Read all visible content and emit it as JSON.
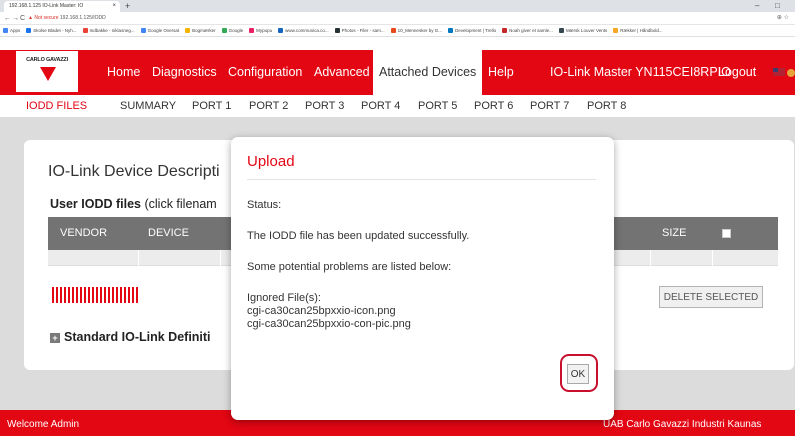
{
  "browser": {
    "tab_title": "192.168.1.125 IO-Link Master: IO",
    "tab_close": "×",
    "new_tab": "+",
    "back": "←",
    "forward": "→",
    "reload": "C",
    "warning": "▲ Not secure",
    "url": "192.168.1.125/IODD",
    "min": "–",
    "max": "□",
    "addr_icons": "⊕ ☆",
    "bookmarks": [
      {
        "label": "Apps",
        "color": "#4285f4"
      },
      {
        "label": "Skolse Bladet - Nyh...",
        "color": "#1a73e8"
      },
      {
        "label": "Indbakke - niklasneg...",
        "color": "#ea4335"
      },
      {
        "label": "Google Oversat",
        "color": "#4285f4"
      },
      {
        "label": "Bogmærker",
        "color": "#f4b400"
      },
      {
        "label": "Google",
        "color": "#34a853"
      },
      {
        "label": "Mypupu",
        "color": "#e91e63"
      },
      {
        "label": "www.communica.co...",
        "color": "#1565c0"
      },
      {
        "label": "Photos - Filer - sam...",
        "color": "#263238"
      },
      {
        "label": "10_Mennesker by G...",
        "color": "#e64a19"
      },
      {
        "label": "Development | Trello",
        "color": "#0079bf"
      },
      {
        "label": "Noah giver et samle...",
        "color": "#c62828"
      },
      {
        "label": "Mærsk Louver Vents",
        "color": "#37474f"
      },
      {
        "label": "Rækker | Håndbold...",
        "color": "#f9a825"
      }
    ]
  },
  "logo": {
    "text": "CARLO GAVAZZI"
  },
  "menu": {
    "items": [
      "Home",
      "Diagnostics",
      "Configuration",
      "Advanced",
      "Attached Devices",
      "Help"
    ],
    "device": "IO-Link Master YN115CEI8RPIO",
    "logout": "Logout"
  },
  "subnav": {
    "items": [
      "IODD FILES",
      "SUMMARY",
      "PORT 1",
      "PORT 2",
      "PORT 3",
      "PORT 4",
      "PORT 5",
      "PORT 6",
      "PORT 7",
      "PORT 8"
    ]
  },
  "page": {
    "title": "IO-Link Device Descripti",
    "user_files_bold": "User IODD files",
    "user_files_rest": " (click filenam",
    "columns": [
      "VENDOR",
      "DEVICE",
      "SIZE"
    ],
    "delete_btn": "DELETE SELECTED",
    "plus": "+",
    "standard": "Standard IO-Link Definiti"
  },
  "footer": {
    "left": "Welcome Admin",
    "right": "UAB Carlo Gavazzi Industri Kaunas"
  },
  "modal": {
    "title": "Upload",
    "status": "Status:",
    "message": "The IODD file has been updated successfully.",
    "problems": "Some potential problems are listed below:",
    "ignored": "Ignored File(s):",
    "file1": "cgi-ca30can25bpxxio-icon.png",
    "file2": "cgi-ca30can25bpxxio-con-pic.png",
    "ok": "OK"
  },
  "colors": {
    "brand_red": "#e30613",
    "header_gray": "#737373"
  }
}
